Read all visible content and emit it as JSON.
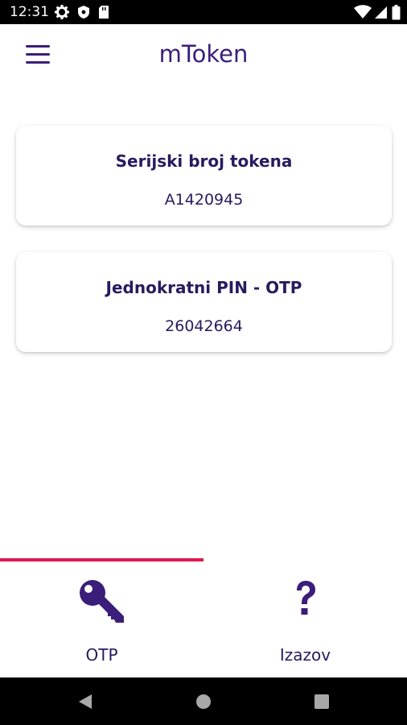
{
  "status_bar": {
    "time": "12:31",
    "icons": [
      "gear-icon",
      "shield-icon",
      "sd-card-icon",
      "wifi-icon",
      "signal-icon",
      "battery-icon"
    ]
  },
  "app_bar": {
    "title": "mToken",
    "menu_icon": "hamburger-menu-icon"
  },
  "cards": [
    {
      "label": "Serijski broj tokena",
      "value": "A1420945"
    },
    {
      "label": "Jednokratni PIN - OTP",
      "value": "26042664"
    }
  ],
  "bottom_nav": {
    "tabs": [
      {
        "label": "OTP",
        "icon": "key-icon",
        "selected": true
      },
      {
        "label": "Izazov",
        "icon": "question-mark-icon",
        "selected": false
      }
    ]
  },
  "system_nav": [
    "back-button",
    "home-button",
    "recents-button"
  ],
  "colors": {
    "primary": "#3b1d7a",
    "accent": "#e0174f",
    "text_dark": "#2a1a5e",
    "status_bar": "#000000",
    "nav_icons": "#a8a8a8"
  }
}
